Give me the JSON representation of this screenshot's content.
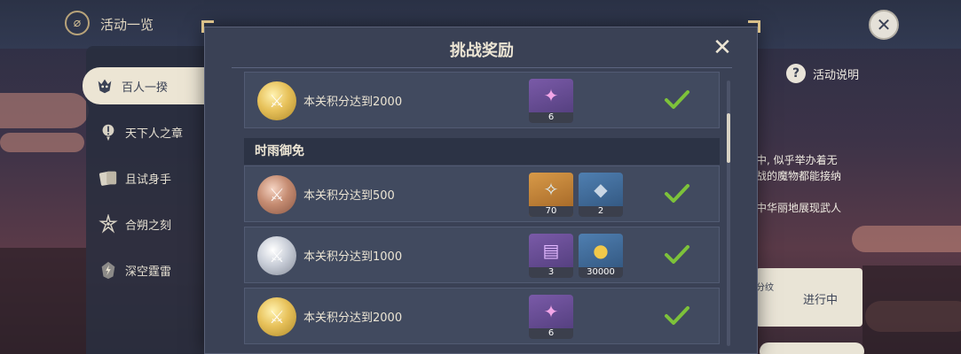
{
  "topbar": {
    "logo_glyph": "⌀",
    "title": "活动一览",
    "close_glyph": "✕"
  },
  "sidebar": {
    "items": [
      {
        "label": "百人一揆",
        "icon": "oni-mask-icon",
        "active": true
      },
      {
        "label": "天下人之章",
        "icon": "warning-icon",
        "active": false
      },
      {
        "label": "且试身手",
        "icon": "cards-icon",
        "active": false
      },
      {
        "label": "合朔之刻",
        "icon": "flower-icon",
        "active": false
      },
      {
        "label": "深空霆雷",
        "icon": "thunder-icon",
        "active": false
      }
    ]
  },
  "right_panel": {
    "help_glyph": "?",
    "help_label": "活动说明",
    "desc_lines": [
      "中, 似乎举办着无",
      "战的魔物都能接纳",
      "中华丽地展现武人"
    ],
    "status_small": "分纹",
    "status_label": "进行中"
  },
  "modal": {
    "title": "挑战奖励",
    "close_glyph": "✕",
    "rows": [
      {
        "type": "row",
        "medal": "gold",
        "label": "本关积分达到2000",
        "rewards": [
          {
            "item": "crystal-icon",
            "glyph": "✦",
            "color": "purple",
            "count": "6"
          }
        ],
        "claimed": true
      },
      {
        "type": "section",
        "label": "时雨御免"
      },
      {
        "type": "row",
        "medal": "bronze",
        "label": "本关积分达到500",
        "rewards": [
          {
            "item": "star-fragment-icon",
            "glyph": "✧",
            "color": "orange",
            "count": "70"
          },
          {
            "item": "ore-icon",
            "glyph": "◆",
            "color": "blue",
            "count": "2"
          }
        ],
        "claimed": true
      },
      {
        "type": "row",
        "medal": "silver",
        "label": "本关积分达到1000",
        "rewards": [
          {
            "item": "talent-book-icon",
            "glyph": "▤",
            "color": "purple",
            "count": "3"
          },
          {
            "item": "mora-icon",
            "glyph": "●",
            "color": "blue",
            "count": "30000"
          }
        ],
        "claimed": true
      },
      {
        "type": "row",
        "medal": "gold",
        "label": "本关积分达到2000",
        "rewards": [
          {
            "item": "crystal-icon",
            "glyph": "✦",
            "color": "purple",
            "count": "6"
          }
        ],
        "claimed": true
      }
    ]
  },
  "colors": {
    "check_green": "#7dc23a",
    "gold_accent": "#d9c089"
  }
}
